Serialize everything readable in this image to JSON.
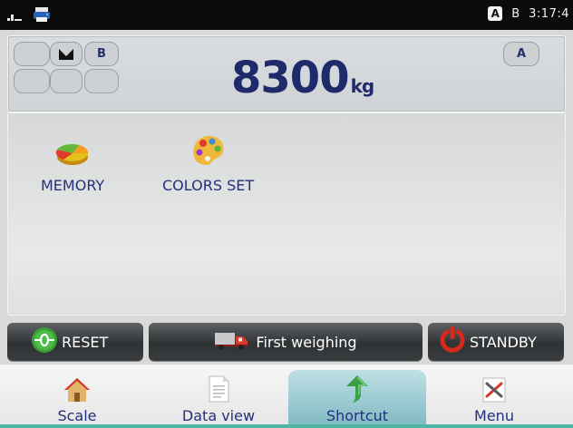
{
  "status": {
    "badge_a": "A",
    "badge_b": "B",
    "time": "3:17:4"
  },
  "weight": {
    "value": "8300",
    "unit": "kg",
    "indicator_b": "B",
    "indicator_a": "A"
  },
  "shortcuts": [
    {
      "label": "MEMORY",
      "icon": "memory-pie-icon"
    },
    {
      "label": "COLORS SET",
      "icon": "palette-icon"
    }
  ],
  "actions": {
    "reset": "RESET",
    "first_weighing": "First weighing",
    "standby": "STANDBY"
  },
  "nav": [
    {
      "label": "Scale",
      "icon": "house-icon"
    },
    {
      "label": "Data view",
      "icon": "document-icon"
    },
    {
      "label": "Shortcut",
      "icon": "arrow-shortcut-icon",
      "active": true
    },
    {
      "label": "Menu",
      "icon": "tools-icon"
    }
  ],
  "colors": {
    "accent_text": "#25307a",
    "status_bar": "#0b0b0b",
    "active_tab": "#7fb8c2",
    "reset_green": "#3aa037",
    "standby_red": "#d52a1b",
    "truck_red": "#d8372b"
  }
}
